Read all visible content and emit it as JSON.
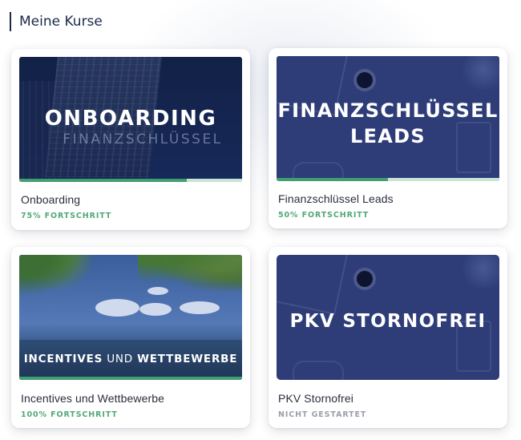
{
  "page": {
    "title": "Meine Kurse"
  },
  "courses": [
    {
      "title": "Onboarding",
      "progress_text": "75% FORTSCHRITT",
      "progress": 0.75,
      "image": {
        "line1": "ONBOARDING",
        "line2": "FINANZSCHLÜSSEL"
      }
    },
    {
      "title": "Finanzschlüssel Leads",
      "progress_text": "50% FORTSCHRITT",
      "progress": 0.5,
      "image": {
        "line1": "FINANZSCHLÜSSEL",
        "line2": "LEADS"
      }
    },
    {
      "title": "Incentives und Wettbewerbe",
      "progress_text": "100% FORTSCHRITT",
      "progress": 1.0,
      "image": {
        "part1": "INCENTIVES",
        "part2": "UND",
        "part3": "WETTBEWERBE"
      }
    },
    {
      "title": "PKV Stornofrei",
      "progress_text": "NICHT GESTARTET",
      "progress": 0,
      "image": {
        "line1": "PKV STORNOFREI"
      }
    }
  ],
  "colors": {
    "progress_fill": "#3f9f70",
    "progress_track": "#c7e4d7",
    "progress_text": "#52a877",
    "not_started_text": "#9aa0a8",
    "header_text": "#1b2a4a"
  }
}
